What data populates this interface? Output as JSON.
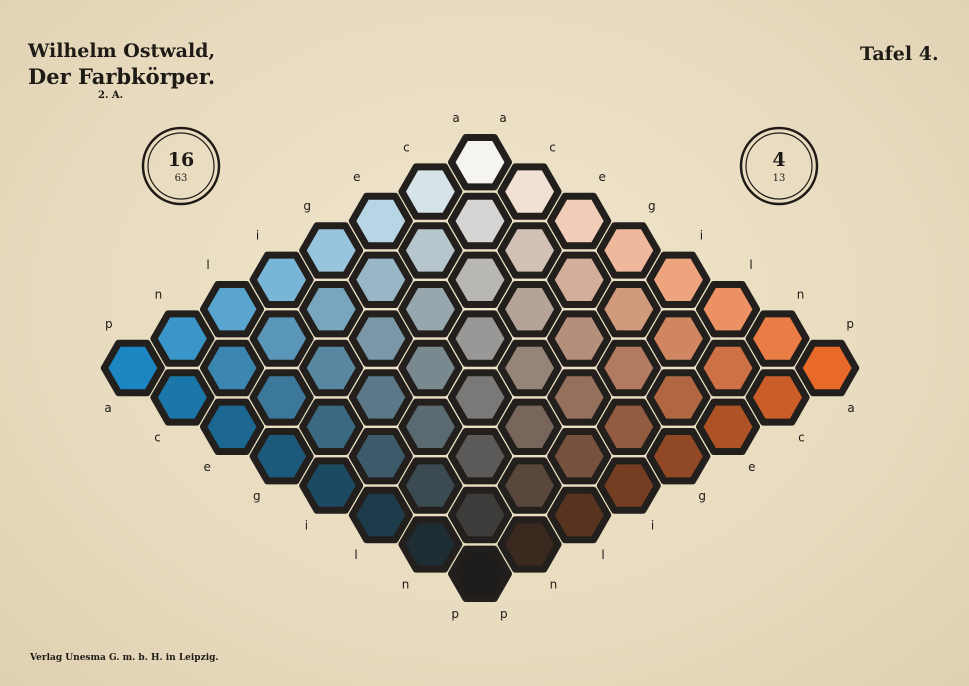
{
  "header": {
    "author": "Wilhelm Ostwald,",
    "title": "Der Farbkörper.",
    "edition": "2. A.",
    "plate": "Tafel 4."
  },
  "badges": {
    "left": {
      "top": "16",
      "bottom": "63"
    },
    "right": {
      "top": "4",
      "bottom": "13"
    }
  },
  "footer": {
    "publisher": "Verlag Unesma G. m. b. H. in Leipzig."
  },
  "scale_letters": [
    "a",
    "c",
    "e",
    "g",
    "i",
    "l",
    "n",
    "p"
  ],
  "colors": {
    "outline": "#231f1c",
    "ink": "#1e1a16",
    "paper": "#e9dcc1"
  },
  "hue_endpoints": {
    "left": "#1b86c2",
    "right": "#e8692a",
    "white": "#f5f4f1",
    "black": "#1e1d1c"
  }
}
